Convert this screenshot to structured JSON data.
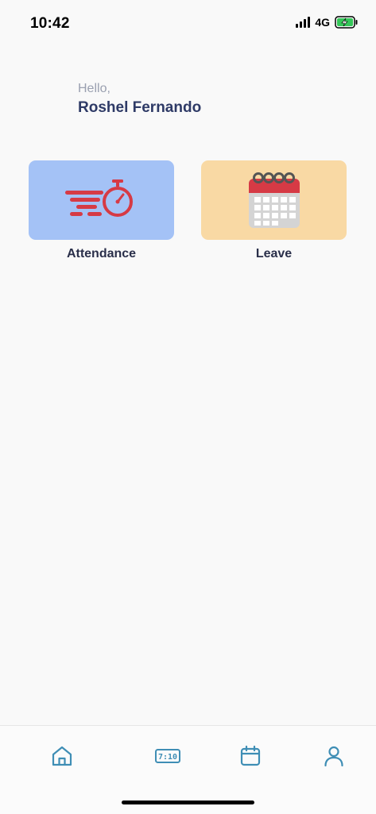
{
  "status_bar": {
    "time": "10:42",
    "network": "4G"
  },
  "greeting": {
    "hello": "Hello,",
    "name": "Roshel Fernando"
  },
  "tiles": [
    {
      "label": "Attendance",
      "icon": "stopwatch-icon",
      "color": "#a4c2f6"
    },
    {
      "label": "Leave",
      "icon": "calendar-icon",
      "color": "#f9d9a4"
    }
  ],
  "bottom_nav": {
    "items": [
      {
        "icon": "home-icon"
      },
      {
        "icon": "clock-display-icon",
        "text": "7:10"
      },
      {
        "icon": "calendar-icon"
      },
      {
        "icon": "profile-icon"
      }
    ],
    "accent": "#3f8eb5"
  }
}
